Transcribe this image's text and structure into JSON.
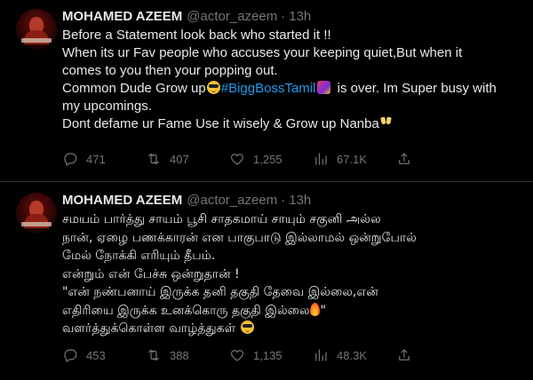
{
  "tweets": [
    {
      "author_name": "MOHAMED AZEEM",
      "handle": "@actor_azeem",
      "separator": "·",
      "time": "13h",
      "lines": {
        "l1": "Before a Statement look back who started it !!",
        "l2": "When its ur Fav people who accuses your keeping quiet,But when it",
        "l3": "comes to you then your popping out.",
        "l4a": "Common Dude Grow up",
        "l4b": "#BiggBossTamil",
        "l4c": " is over. Im Super busy with",
        "l5": "my upcomings.",
        "l6": "Dont defame ur Fame Use it wisely & Grow up Nanba"
      },
      "stats": {
        "replies": "471",
        "retweets": "407",
        "likes": "1,255",
        "views": "67.1K"
      }
    },
    {
      "author_name": "MOHAMED AZEEM",
      "handle": "@actor_azeem",
      "separator": "·",
      "time": "13h",
      "lines": {
        "l1": "சமயம் பார்த்து சாயம் பூசி சாதகமாய் சாயும் சகுனி அல்ல",
        "l2": "நான், ஏழை பணக்காரன் என பாகுபாடு இல்லாமல் ஒன்றுபோல்",
        "l3": "மேல் நோக்கி எரியும் தீபம்.",
        "l4": "என்றும் என் பேச்சு ஒன்றுதான் !",
        "l5": "\"என் நண்பனாய் இருக்க தனி தகுதி தேவை இல்லை,என்",
        "l6": "எதிரியை இருக்க உனக்கொரு தகுதி இல்லை",
        "l6end": "\"",
        "l7": "வளர்த்துக்கொள்ள வாழ்த்துகள் "
      },
      "stats": {
        "replies": "453",
        "retweets": "388",
        "likes": "1,135",
        "views": "48.3K"
      }
    }
  ],
  "icons": {
    "reply": "reply-icon",
    "retweet": "retweet-icon",
    "like": "like-icon",
    "views": "views-icon",
    "share": "share-icon"
  },
  "colors": {
    "background": "#000000",
    "text": "#e7e9ea",
    "muted": "#71767b",
    "link": "#1d9bf0",
    "divider": "#2f3336"
  }
}
